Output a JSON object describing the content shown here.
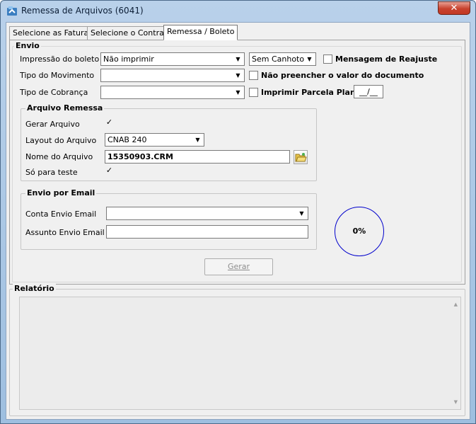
{
  "window": {
    "title": "Remessa de Arquivos (6041)",
    "close_label": "✕"
  },
  "tabs": [
    {
      "label": "Selecione as Faturas"
    },
    {
      "label": "Selecione o Contrato"
    },
    {
      "label": "Remessa / Boleto"
    }
  ],
  "envio": {
    "title": "Envio",
    "impressao_label": "Impressão do boleto",
    "impressao_value": "Não imprimir",
    "canhoto_value": "Sem Canhoto",
    "mensagem_reajuste_label": "Mensagem de Reajuste",
    "tipo_movimento_label": "Tipo do Movimento",
    "tipo_movimento_value": "",
    "nao_preencher_label": "Não preencher o valor do documento",
    "tipo_cobranca_label": "Tipo de Cobrança",
    "tipo_cobranca_value": "",
    "imprimir_parcela_label": "Imprimir Parcela Plano",
    "parcela_value": "__/__"
  },
  "arquivo_remessa": {
    "title": "Arquivo Remessa",
    "gerar_label": "Gerar Arquivo",
    "layout_label": "Layout do Arquivo",
    "layout_value": "CNAB 240",
    "nome_label": "Nome do Arquivo",
    "nome_value": "15350903.CRM",
    "teste_label": "Só para teste"
  },
  "envio_email": {
    "title": "Envio por Email",
    "conta_label": "Conta Envio Email",
    "conta_value": "",
    "assunto_label": "Assunto Envio Email",
    "assunto_value": ""
  },
  "progress": {
    "text": "0%",
    "percent": 0
  },
  "gerar_button": "Gerar",
  "relatorio": {
    "title": "Relatório"
  },
  "checkmark": "✓"
}
